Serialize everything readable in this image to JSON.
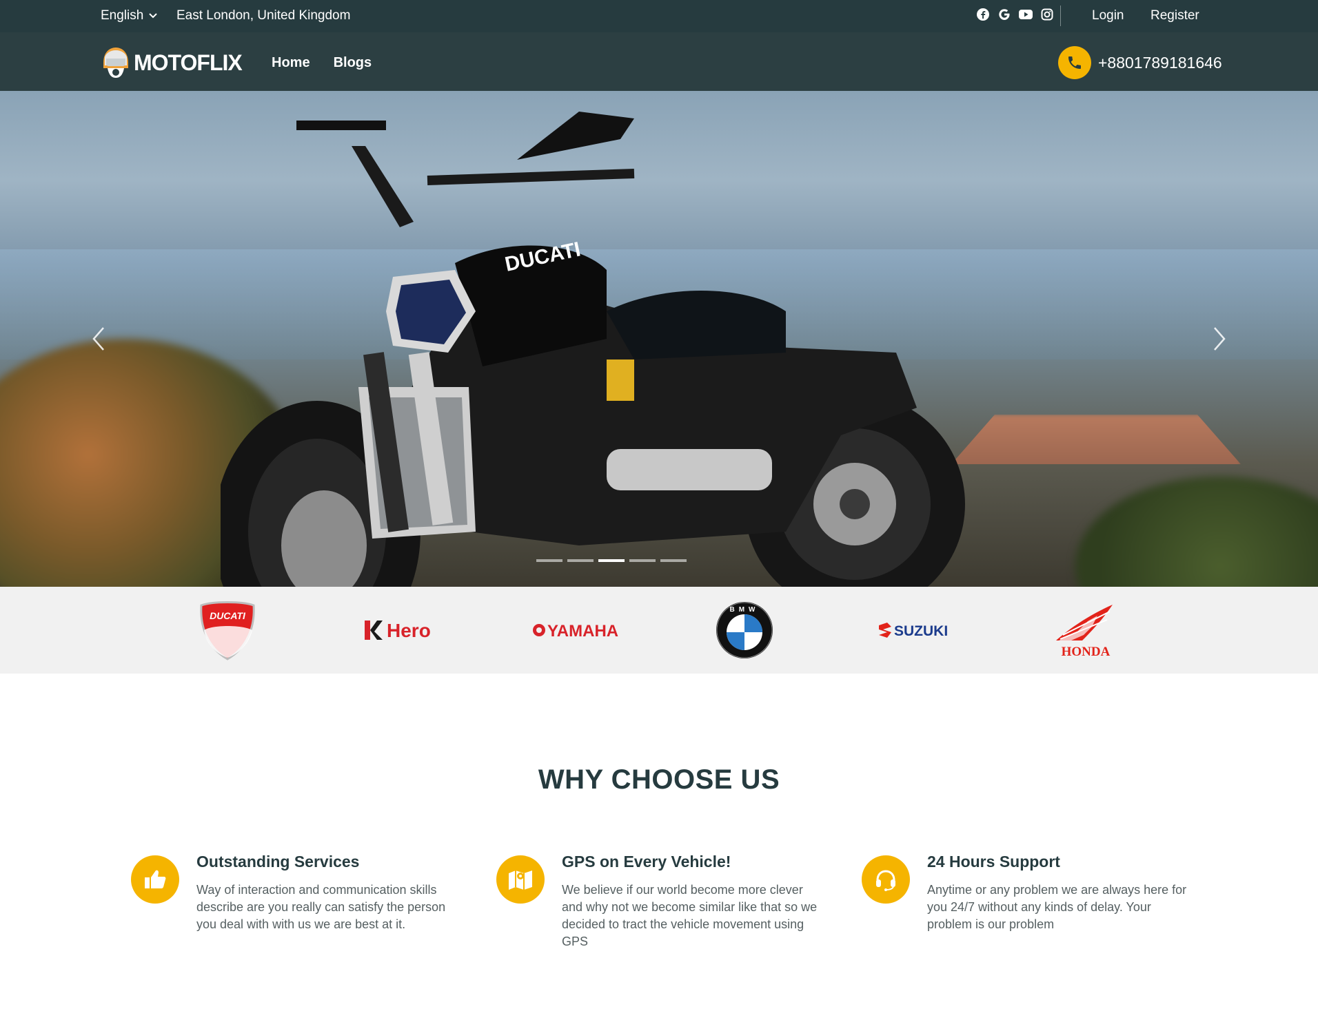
{
  "topbar": {
    "language": "English",
    "location": "East London, United Kingdom",
    "social_icons": [
      "facebook-icon",
      "google-icon",
      "youtube-icon",
      "instagram-icon"
    ],
    "login": "Login",
    "register": "Register"
  },
  "navbar": {
    "logo_text": "MOTOFLIX",
    "links": [
      "Home",
      "Blogs"
    ],
    "phone": "+8801789181646"
  },
  "hero": {
    "bike_brand_text": "DUCATI",
    "slides_count": 5,
    "active_slide": 3
  },
  "brands": [
    "DUCATI",
    "Hero",
    "YAMAHA",
    "BMW",
    "SUZUKI",
    "HONDA"
  ],
  "why": {
    "title": "WHY CHOOSE US",
    "features": [
      {
        "icon": "thumbs-up-icon",
        "title": "Outstanding Services",
        "text": "Way of interaction and communication skills describe are you really can satisfy the person you deal with with us we are best at it."
      },
      {
        "icon": "map-icon",
        "title": "GPS on Every Vehicle!",
        "text": "We believe if our world become more clever and why not we become similar like that so we decided to tract the vehicle movement using GPS"
      },
      {
        "icon": "headset-icon",
        "title": "24 Hours Support",
        "text": "Anytime or any problem we are always here for you 24/7 without any kinds of delay. Your problem is our problem"
      }
    ]
  },
  "colors": {
    "topbar_bg": "#263b3f",
    "navbar_bg": "#2c3f42",
    "accent": "#f5b400",
    "heading": "#263b3f"
  }
}
